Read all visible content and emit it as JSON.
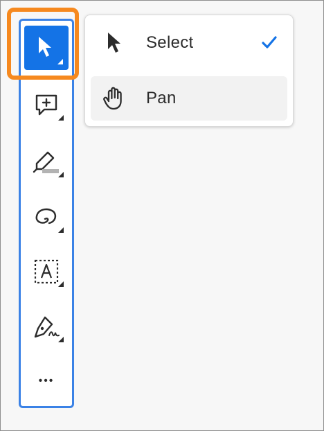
{
  "window": {
    "title": ""
  },
  "colors": {
    "accent": "#1473e6",
    "toolbar_border": "#3b82e6",
    "highlight": "#f6891f",
    "icon": "#2c2c2c",
    "check": "#1473e6"
  },
  "toolbar": {
    "tools": [
      {
        "id": "select",
        "icon": "arrow-pointer-icon",
        "selected": true
      },
      {
        "id": "comment",
        "icon": "add-comment-icon"
      },
      {
        "id": "highlight",
        "icon": "highlighter-icon"
      },
      {
        "id": "draw",
        "icon": "freehand-loop-icon"
      },
      {
        "id": "text",
        "icon": "text-box-icon"
      },
      {
        "id": "sign",
        "icon": "pen-sign-icon"
      },
      {
        "id": "more",
        "icon": "more-icon",
        "glyph": "•••"
      }
    ]
  },
  "menu": {
    "items": [
      {
        "label": "Select",
        "icon": "arrow-pointer-icon",
        "checked": true
      },
      {
        "label": "Pan",
        "icon": "hand-icon",
        "checked": false
      }
    ]
  }
}
